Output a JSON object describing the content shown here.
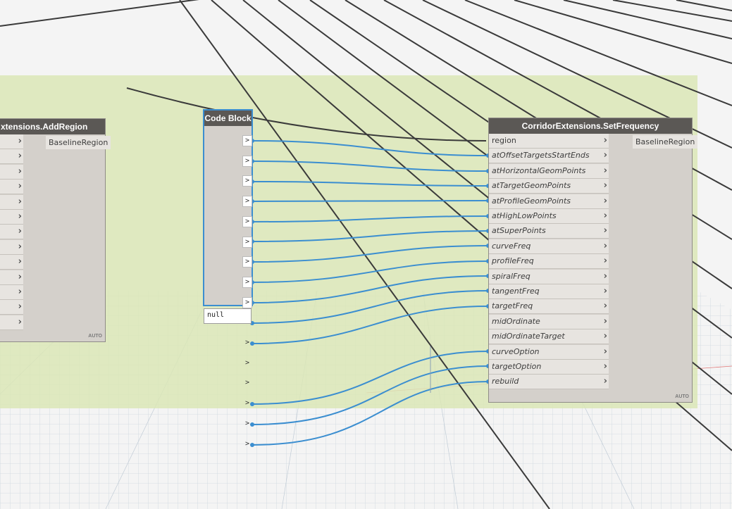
{
  "add_region_node": {
    "title": "xtensions.AddRegion",
    "output": "BaselineRegion",
    "auto": "AUTO"
  },
  "code_block": {
    "title": "Code Block",
    "port_chevron": ">",
    "preview": "null"
  },
  "set_frequency_node": {
    "title": "CorridorExtensions.SetFrequency",
    "inputs": [
      "region",
      "atOffsetTargetsStartEnds",
      "atHorizontalGeomPoints",
      "atTargetGeomPoints",
      "atProfileGeomPoints",
      "atHighLowPoints",
      "atSuperPoints",
      "curveFreq",
      "profileFreq",
      "spiralFreq",
      "tangentFreq",
      "targetFreq",
      "midOrdinate",
      "midOrdinateTarget",
      "curveOption",
      "targetOption",
      "rebuild"
    ],
    "output": "BaselineRegion",
    "auto": "AUTO"
  },
  "colors": {
    "group_background": "#dbe6b6",
    "wire_blue": "#3b8ed0",
    "wire_dark": "#3a3a3a",
    "node_header": "#5b5855"
  },
  "icons": [
    "port-chevron-icon"
  ]
}
